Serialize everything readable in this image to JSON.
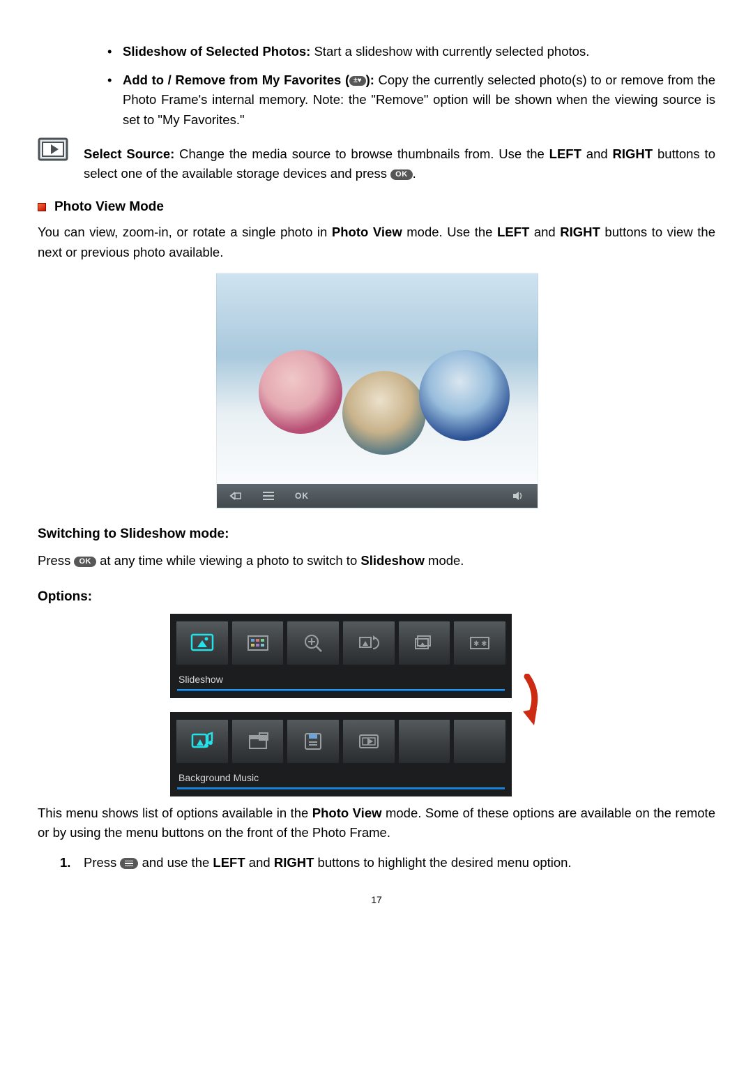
{
  "bullets": {
    "slideshow": {
      "label": "Slideshow of Selected Photos:",
      "text": " Start a slideshow with currently selected photos."
    },
    "favorites": {
      "label_a": "Add to / Remove from My Favorites (",
      "label_b": "):",
      "heart": "±♥",
      "text": " Copy the currently selected photo(s) to or remove from the Photo Frame's internal memory. Note: the \"Remove\" option will be shown when the viewing source is set to \"My Favorites.\""
    }
  },
  "select_source": {
    "label": "Select Source:",
    "text_a": " Change the media source to browse thumbnails from. Use the ",
    "left": "LEFT",
    "and": " and ",
    "right": "RIGHT",
    "text_b": " buttons to select one of the available storage devices and press ",
    "ok": "OK",
    "dot": "."
  },
  "pvm": {
    "heading": "Photo View Mode",
    "p_a": "You can view, zoom-in, or rotate a single photo in ",
    "bold1": "Photo View",
    "p_b": " mode. Use the ",
    "left": "LEFT",
    "and": " and ",
    "right": "RIGHT",
    "p_c": " buttons to view the next or previous photo available."
  },
  "photobar": {
    "ok": "OK"
  },
  "switch": {
    "heading": "Switching to Slideshow mode:",
    "p_a": "Press ",
    "ok": "OK",
    "p_b": " at any time while viewing a photo to switch to ",
    "bold": "Slideshow",
    "p_c": " mode."
  },
  "options": {
    "heading": "Options:",
    "row1_label": "Slideshow",
    "row2_label": "Background Music",
    "p_a": "This menu shows list of options available in the ",
    "bold": "Photo View",
    "p_b": " mode. Some of these options are available on the remote or by using the menu buttons on the front of the Photo Frame."
  },
  "step1": {
    "num": "1.",
    "a": "Press ",
    "b": " and use the ",
    "left": "LEFT",
    "and": " and ",
    "right": "RIGHT",
    "c": " buttons to highlight the desired menu option."
  },
  "page_number": "17"
}
